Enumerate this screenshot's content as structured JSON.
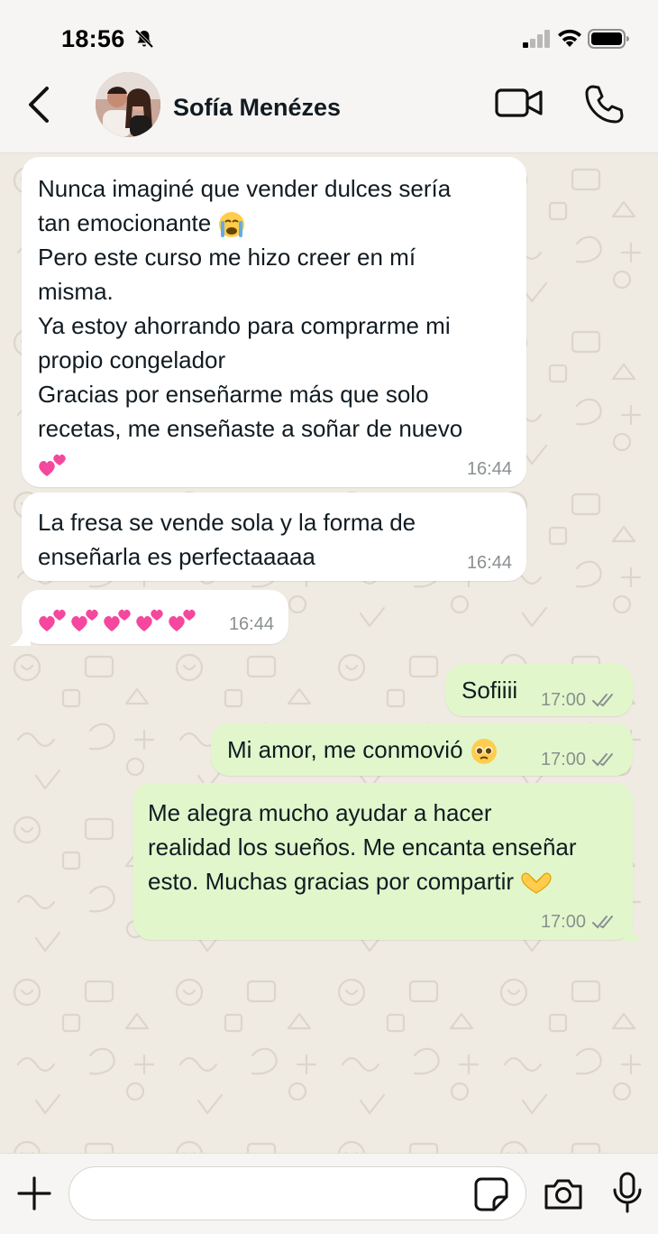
{
  "status_bar": {
    "time": "18:56"
  },
  "header": {
    "contact_name": "Sofía Menézes"
  },
  "messages": [
    {
      "direction": "in",
      "lines": [
        "Nunca imaginé que vender dulces sería",
        "tan emocionante",
        "Pero este curso me hizo creer en mí",
        "misma.",
        "Ya estoy ahorrando para comprarme mi",
        "propio congelador",
        "Gracias por enseñarme más que solo",
        "recetas, me enseñaste a soñar de nuevo"
      ],
      "time": "16:44"
    },
    {
      "direction": "in",
      "lines": [
        "La fresa se vende sola y la forma de",
        "enseñarla es perfectaaaaa"
      ],
      "time": "16:44"
    },
    {
      "direction": "in",
      "lines": [],
      "time": "16:44"
    },
    {
      "direction": "out",
      "lines": [
        "Sofiiii"
      ],
      "time": "17:00"
    },
    {
      "direction": "out",
      "lines": [
        "Mi amor, me conmovió"
      ],
      "time": "17:00"
    },
    {
      "direction": "out",
      "lines": [
        "Me alegra mucho ayudar a hacer",
        "realidad los sueños. Me encanta enseñar",
        "esto. Muchas gracias por compartir"
      ],
      "time": "17:00"
    }
  ],
  "icons": {
    "status": [
      "bell-slash-icon",
      "signal-icon",
      "wifi-icon",
      "battery-icon"
    ],
    "header": [
      "back-icon",
      "video-call-icon",
      "phone-icon"
    ],
    "input": [
      "plus-icon",
      "sticker-icon",
      "camera-icon",
      "microphone-icon"
    ],
    "emoji": [
      "crying-face-emoji",
      "two-hearts-emoji",
      "pleading-face-emoji",
      "heart-hands-emoji"
    ]
  },
  "colors": {
    "incoming_bubble": "#ffffff",
    "outgoing_bubble": "#e1f7cb",
    "chat_background": "#efeae2",
    "bar_background": "#f6f5f3",
    "read_ticks": "#8a8f92"
  }
}
